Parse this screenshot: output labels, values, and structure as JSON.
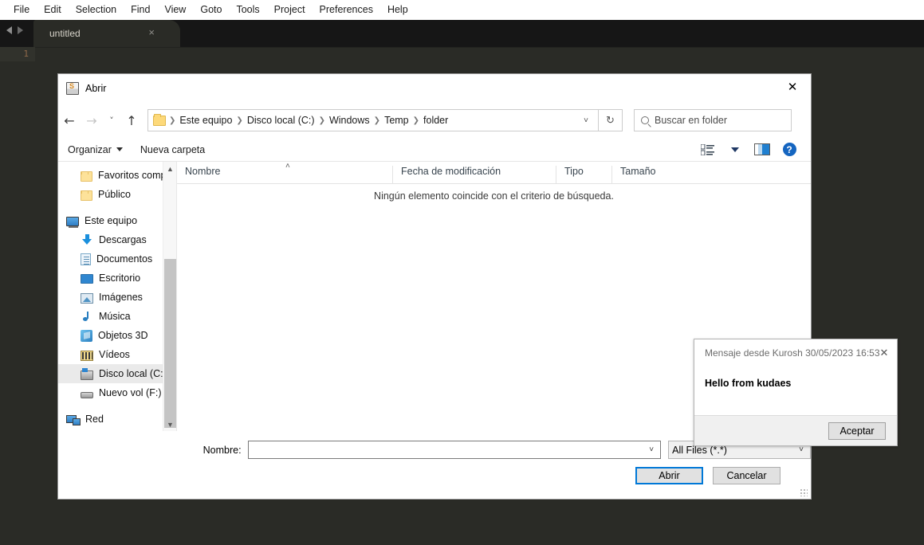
{
  "editor": {
    "menu": [
      "File",
      "Edit",
      "Selection",
      "Find",
      "View",
      "Goto",
      "Tools",
      "Project",
      "Preferences",
      "Help"
    ],
    "tab": {
      "label": "untitled",
      "close": "×"
    },
    "nav_back_icon": "nav-back-arrow",
    "nav_forward_icon": "nav-forward-arrow",
    "line_number": "1",
    "background_color": "#2a2b26",
    "tabbar_color": "#161616"
  },
  "dialog": {
    "title": "Abrir",
    "close_glyph": "✕",
    "nav": {
      "back_glyph": "←",
      "forward_glyph": "→",
      "recent_glyph": "˅",
      "up_glyph": "↑",
      "crumbs": [
        "Este equipo",
        "Disco local (C:)",
        "Windows",
        "Temp",
        "folder"
      ],
      "separator": "❯",
      "crumb_caret": "˅",
      "refresh_glyph": "↻"
    },
    "search": {
      "placeholder": "Buscar en folder"
    },
    "commands": {
      "organize": "Organizar",
      "new_folder": "Nueva carpeta"
    },
    "toolbar_icons": [
      "list-view-icon",
      "view-dropdown-caret",
      "preview-pane-icon",
      "help-icon"
    ],
    "help_label": "?",
    "sidebar": [
      {
        "label": "Favoritos compa",
        "icon": "folder-icon",
        "indent": true,
        "selected": false
      },
      {
        "label": "Público",
        "icon": "folder-icon",
        "indent": true,
        "selected": false
      },
      {
        "label": "Este equipo",
        "icon": "computer-icon",
        "indent": false,
        "selected": false
      },
      {
        "label": "Descargas",
        "icon": "downloads-icon",
        "indent": true,
        "selected": false
      },
      {
        "label": "Documentos",
        "icon": "documents-icon",
        "indent": true,
        "selected": false
      },
      {
        "label": "Escritorio",
        "icon": "desktop-icon",
        "indent": true,
        "selected": false
      },
      {
        "label": "Imágenes",
        "icon": "pictures-icon",
        "indent": true,
        "selected": false
      },
      {
        "label": "Música",
        "icon": "music-icon",
        "indent": true,
        "selected": false
      },
      {
        "label": "Objetos 3D",
        "icon": "objects3d-icon",
        "indent": true,
        "selected": false
      },
      {
        "label": "Vídeos",
        "icon": "videos-icon",
        "indent": true,
        "selected": false
      },
      {
        "label": "Disco local (C:)",
        "icon": "harddisk-icon",
        "indent": true,
        "selected": true
      },
      {
        "label": "Nuevo vol (F:)",
        "icon": "drive-icon",
        "indent": true,
        "selected": false
      },
      {
        "label": "Red",
        "icon": "network-icon",
        "indent": false,
        "selected": false
      }
    ],
    "columns": [
      "Nombre",
      "Fecha de modificación",
      "Tipo",
      "Tamaño"
    ],
    "sort_indicator": "˄",
    "empty_message": "Ningún elemento coincide con el criterio de búsqueda.",
    "footer": {
      "name_label": "Nombre:",
      "name_value": "",
      "name_caret": "˅",
      "filetype_value": "All Files (*.*)",
      "filetype_caret": "˅",
      "open_button": "Abrir",
      "cancel_button": "Cancelar"
    }
  },
  "toast": {
    "title": "Mensaje desde Kurosh 30/05/2023 16:53",
    "close_glyph": "✕",
    "body": "Hello from kudaes",
    "ok_button": "Aceptar"
  }
}
